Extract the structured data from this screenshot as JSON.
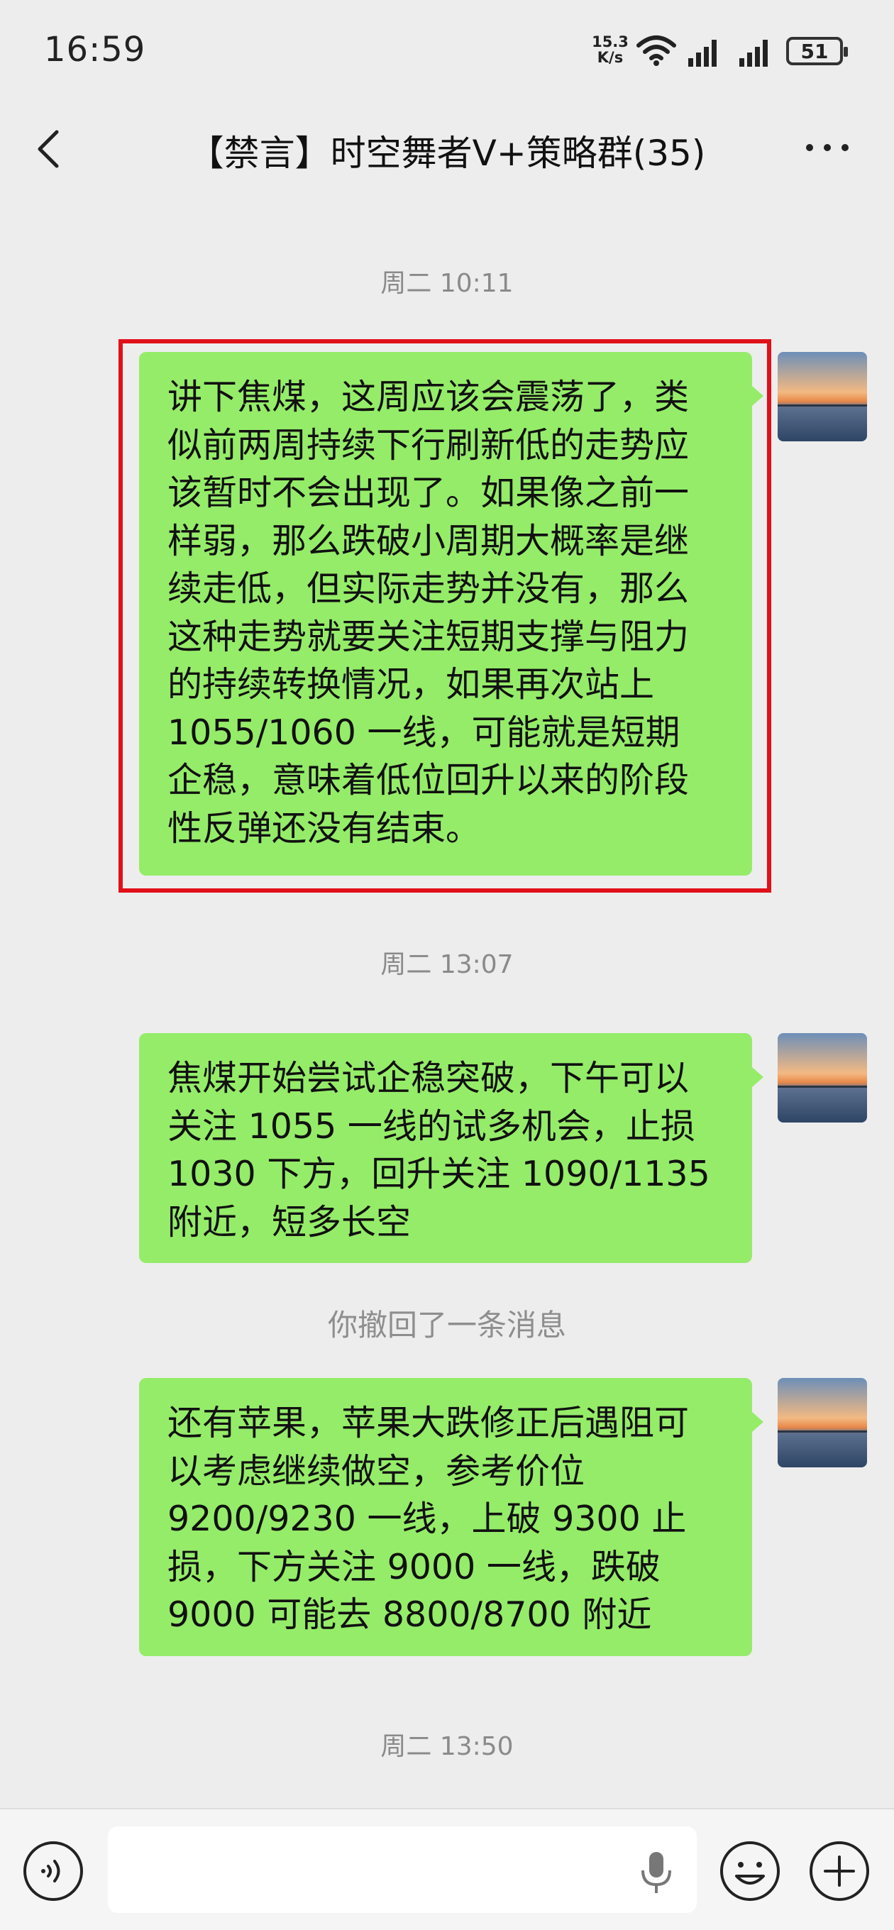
{
  "status_bar": {
    "time": "16:59",
    "net_speed_value": "15.3",
    "net_speed_unit": "K/s",
    "battery": "51",
    "icons": [
      "wifi-icon",
      "signal-icon",
      "signal-icon",
      "battery-icon"
    ]
  },
  "header": {
    "title": "【禁言】时空舞者V+策略群(35)",
    "back_icon": "chevron-left-icon",
    "more_icon": "more-dots-icon"
  },
  "messages": [
    {
      "timestamp": "周二 10:11",
      "lines": [
        "讲下焦煤，这周应该会震荡了，类",
        "似前两周持续下行刷新低的走势应",
        "该暂时不会出现了。如果像之前一",
        "样弱，那么跌破小周期大概率是继",
        "续走低，但实际走势并没有，那么",
        "这种走势就要关注短期支撑与阻力",
        "的持续转换情况，如果再次站上",
        "1055/1060 一线，可能就是短期",
        "企稳，意味着低位回升以来的阶段",
        "性反弹还没有结束。"
      ]
    },
    {
      "timestamp": "周二 13:07",
      "lines": [
        "焦煤开始尝试企稳突破，下午可以",
        "关注 1055 一线的试多机会，止损",
        "1030 下方，回升关注 1090/1135",
        "附近，短多长空"
      ]
    },
    {
      "lines": [
        "还有苹果，苹果大跌修正后遇阻可",
        "以考虑继续做空，参考价位",
        "9200/9230 一线，上破 9300 止",
        "损，下方关注 9000 一线，跌破",
        "9000 可能去 8800/8700 附近"
      ]
    }
  ],
  "recall_notice": "你撤回了一条消息",
  "last_timestamp": "周二 13:50",
  "input_bar": {
    "placeholder": "",
    "icons": [
      "voice-toggle-icon",
      "microphone-icon",
      "emoji-icon",
      "plus-icon"
    ]
  },
  "colors": {
    "background": "#ededed",
    "bubble": "#95ec69",
    "highlight": "#e0101a",
    "timestamp": "#8a8a8a"
  }
}
